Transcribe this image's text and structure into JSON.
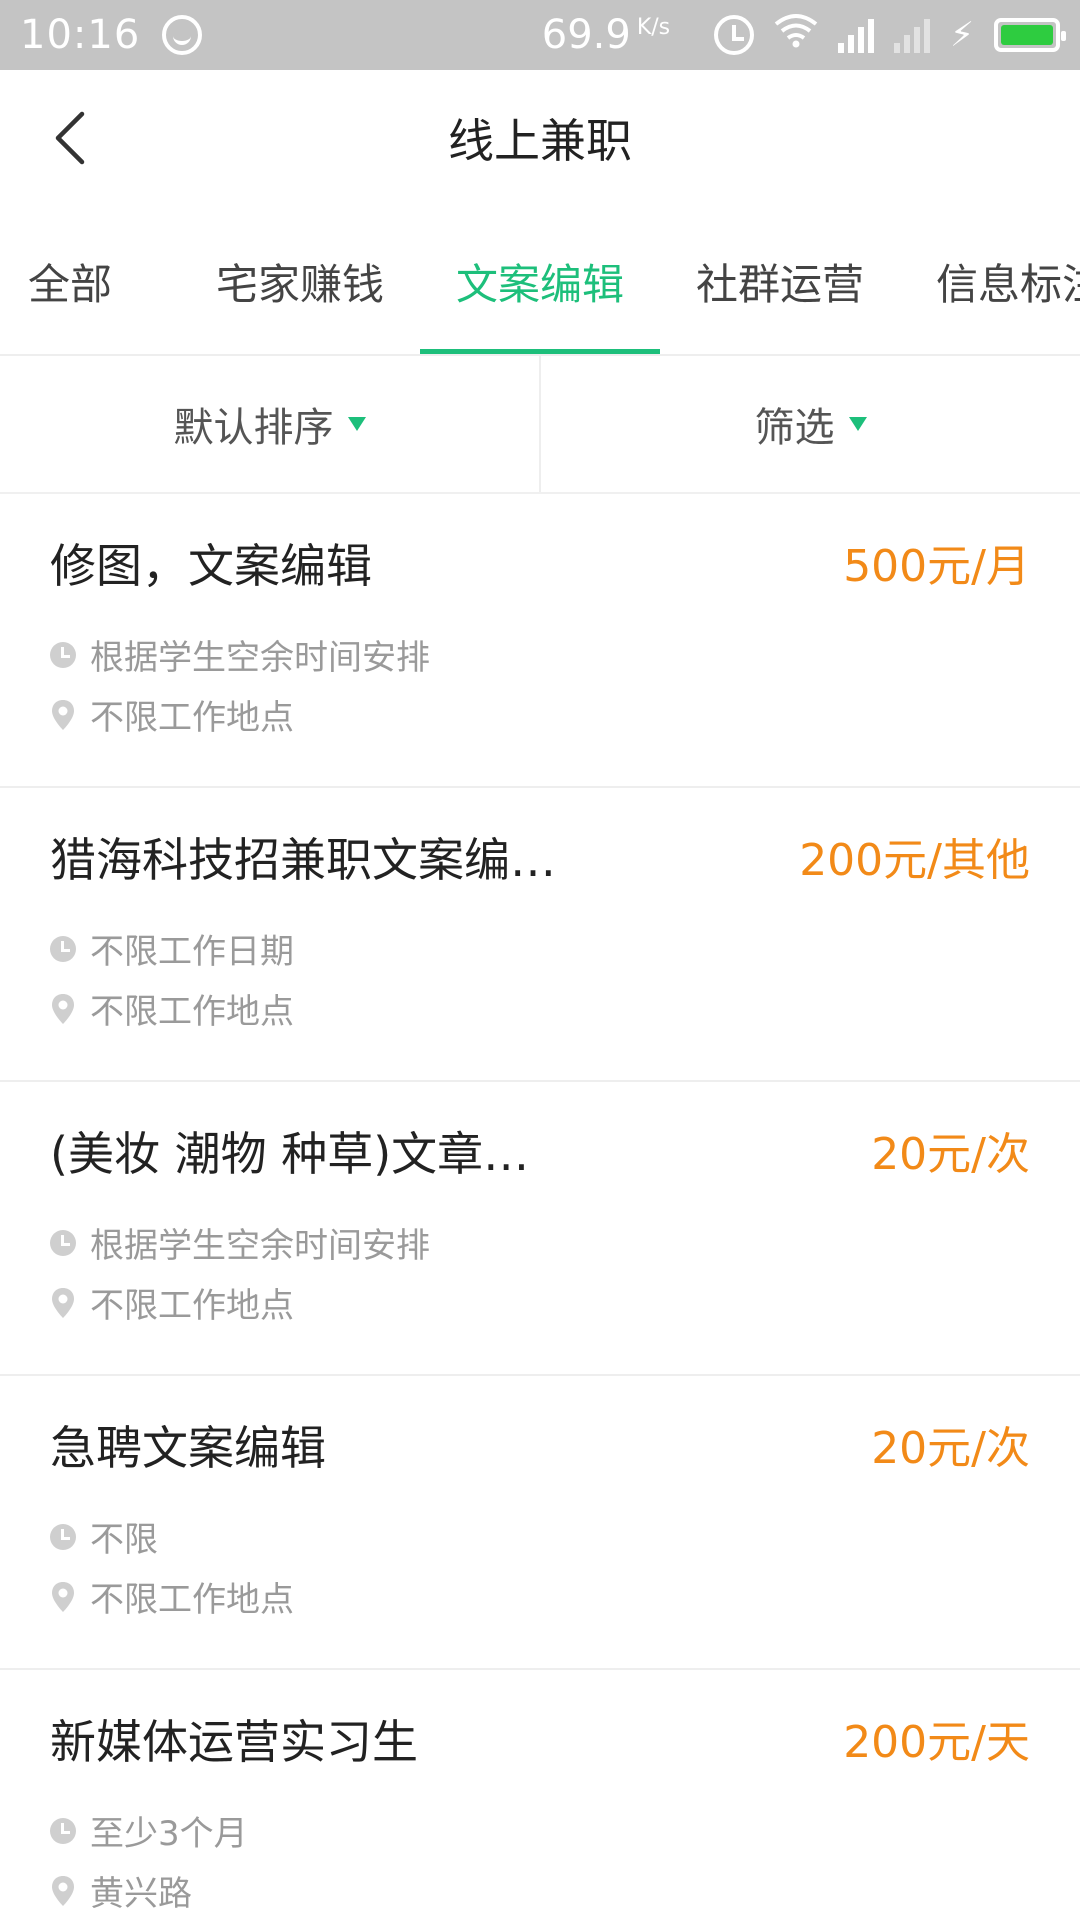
{
  "status_bar": {
    "time": "10:16",
    "speed": "69.9",
    "speed_unit": "K/s",
    "battery_color": "#2ecc40"
  },
  "header": {
    "title": "线上兼职",
    "back_icon": "chevron-left-icon"
  },
  "tabs": [
    {
      "label": "全部",
      "active": false
    },
    {
      "label": "宅家赚钱",
      "active": false
    },
    {
      "label": "文案编辑",
      "active": true
    },
    {
      "label": "社群运营",
      "active": false
    },
    {
      "label": "信息标注",
      "active": false
    }
  ],
  "filters": {
    "sort_label": "默认排序",
    "filter_label": "筛选"
  },
  "colors": {
    "accent": "#1dbf7b",
    "salary": "#f28a18",
    "meta_text": "#9a9a9a"
  },
  "jobs": [
    {
      "title": "修图，文案编辑",
      "salary": "500元/月",
      "time": "根据学生空余时间安排",
      "place": "不限工作地点"
    },
    {
      "title": "猎海科技招兼职文案编…",
      "salary": "200元/其他",
      "time": "不限工作日期",
      "place": "不限工作地点"
    },
    {
      "title": "(美妆 潮物 种草)文章…",
      "salary": "20元/次",
      "time": "根据学生空余时间安排",
      "place": "不限工作地点"
    },
    {
      "title": "急聘文案编辑",
      "salary": "20元/次",
      "time": "不限",
      "place": "不限工作地点"
    },
    {
      "title": "新媒体运营实习生",
      "salary": "200元/天",
      "time": "至少3个月",
      "place": "黄兴路"
    }
  ]
}
